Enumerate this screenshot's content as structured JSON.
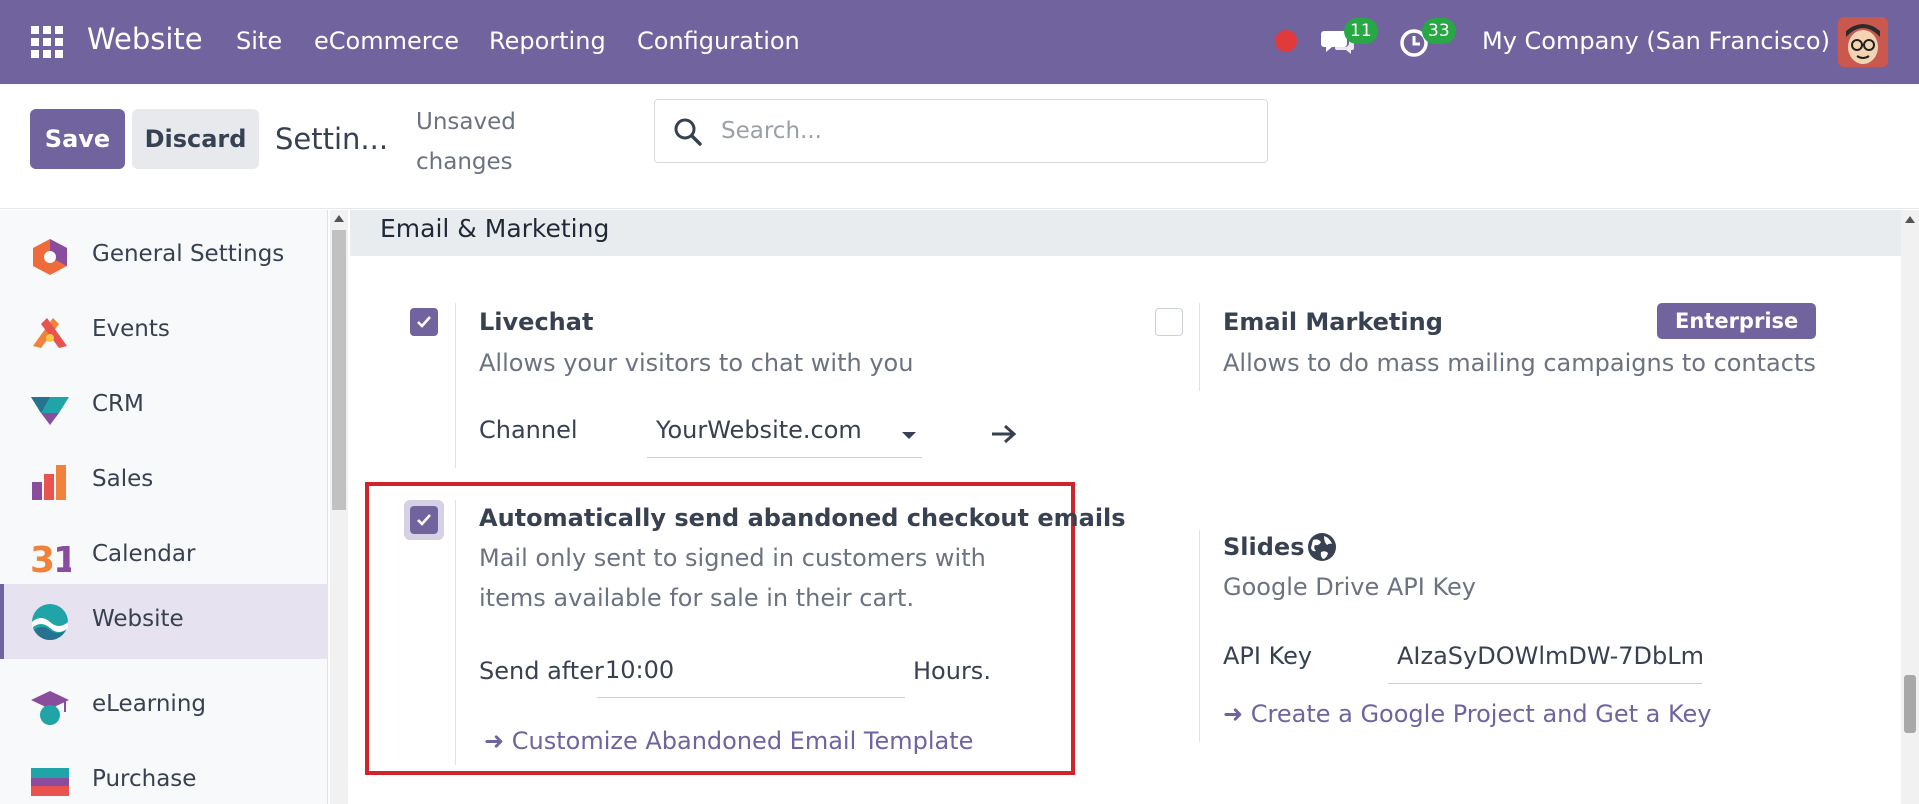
{
  "navbar": {
    "brand": "Website",
    "menu": [
      "Site",
      "eCommerce",
      "Reporting",
      "Configuration"
    ],
    "chat_count": "11",
    "activity_count": "33",
    "company": "My Company (San Francisco)",
    "icons": [
      "apps-grid-icon",
      "record-dot-icon",
      "chat-icon",
      "clock-icon",
      "avatar"
    ],
    "colors": {
      "bar": "#71639e",
      "badge": "#28a745",
      "record": "#e03a3a"
    }
  },
  "control": {
    "save_label": "Save",
    "discard_label": "Discard",
    "breadcrumb": "Settin...",
    "unsaved_label": "Unsaved changes",
    "search_placeholder": "Search..."
  },
  "sidebar": {
    "items": [
      {
        "label": "General Settings",
        "icon": "general-settings-icon",
        "active": false
      },
      {
        "label": "Events",
        "icon": "events-icon",
        "active": false
      },
      {
        "label": "CRM",
        "icon": "crm-icon",
        "active": false
      },
      {
        "label": "Sales",
        "icon": "sales-icon",
        "active": false
      },
      {
        "label": "Calendar",
        "icon": "calendar-icon",
        "active": false
      },
      {
        "label": "Website",
        "icon": "website-icon",
        "active": true
      },
      {
        "label": "eLearning",
        "icon": "elearning-icon",
        "active": false
      },
      {
        "label": "Purchase",
        "icon": "purchase-icon",
        "active": false
      }
    ]
  },
  "section": {
    "title": "Email & Marketing"
  },
  "livechat": {
    "title": "Livechat",
    "description": "Allows your visitors to chat with you",
    "checked": true,
    "channel_label": "Channel",
    "channel_value": "YourWebsite.com"
  },
  "email_marketing": {
    "title": "Email Marketing",
    "description": "Allows to do mass mailing campaigns to contacts",
    "badge": "Enterprise",
    "checked": false
  },
  "abandoned": {
    "title": "Automatically send abandoned checkout emails",
    "description": "Mail only sent to signed in customers with items available for sale in their cart.",
    "checked": true,
    "send_after_label": "Send after",
    "send_after_value": "10:00",
    "hours_label": "Hours.",
    "template_link": "Customize Abandoned Email Template"
  },
  "slides": {
    "title": "Slides",
    "icon": "globe-icon",
    "description": "Google Drive API Key",
    "api_key_label": "API Key",
    "api_key_value": "AIzaSyDOWlmDW-7DbLm",
    "project_link": "Create a Google Project and Get a Key"
  }
}
